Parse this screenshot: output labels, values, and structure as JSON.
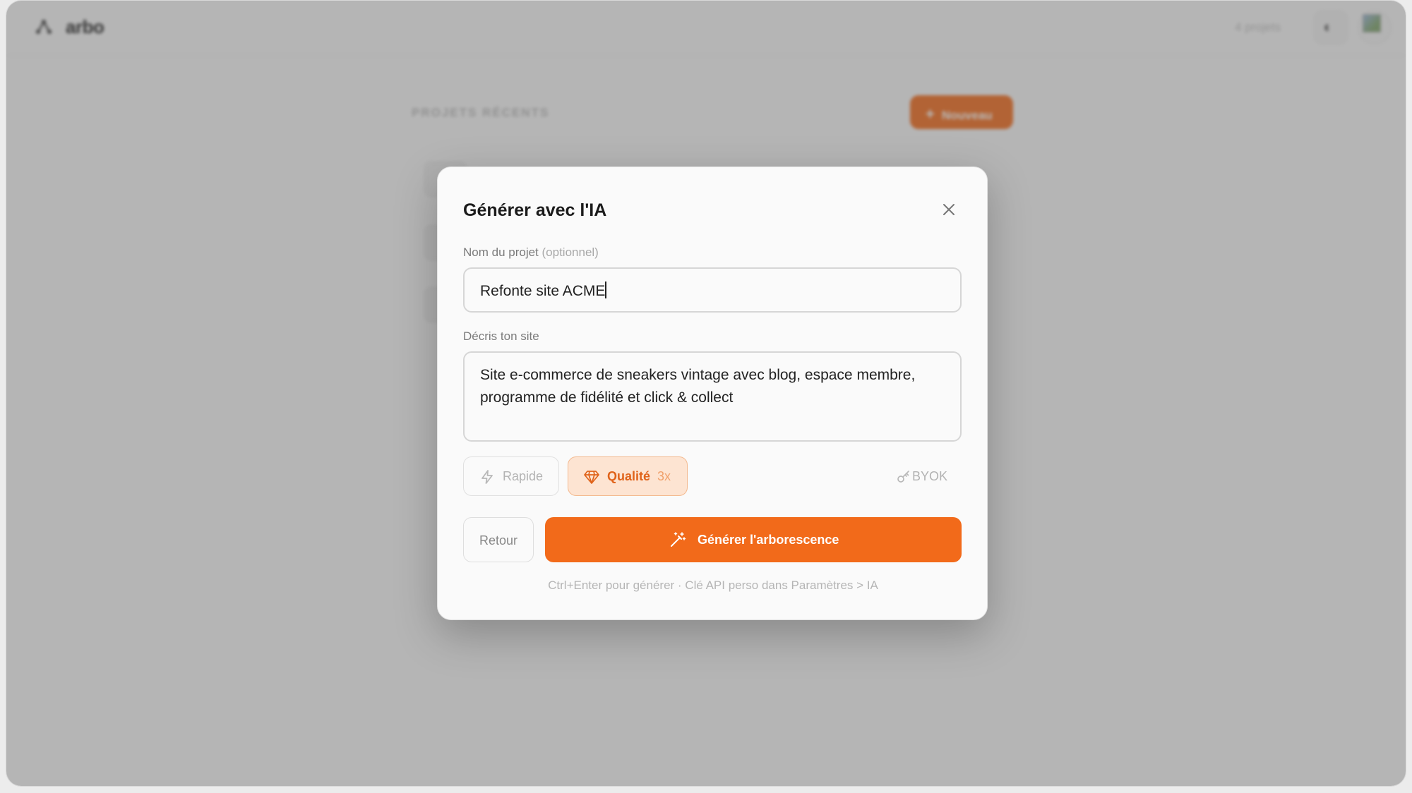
{
  "app": {
    "name": "arbo",
    "projects_count": "4 projets",
    "section_label": "PROJETS RÉCENTS",
    "new_button": "Nouveau"
  },
  "modal": {
    "title": "Générer avec l'IA",
    "name_label": "Nom du projet",
    "name_optional": "(optionnel)",
    "name_value": "Refonte site ACME",
    "description_label": "Décris ton site",
    "description_value": "Site e-commerce de sneakers vintage avec blog, espace membre, programme de fidélité et click & collect",
    "modes": {
      "fast_label": "Rapide",
      "quality_label": "Qualité",
      "quality_multiplier": "3x",
      "selected": "Qualité"
    },
    "byok_label": "BYOK",
    "back_button": "Retour",
    "generate_button": "Générer l'arborescence",
    "hint": "Ctrl+Enter pour générer · Clé API perso dans Paramètres > IA"
  },
  "colors": {
    "accent": "#f26a1a",
    "accent_soft": "#fde4d2",
    "overlay": "#8a8a8a"
  },
  "icons": {
    "logo": "tree-logo-icon",
    "theme": "moon-icon",
    "close": "close-icon",
    "fast": "lightning-icon",
    "quality": "diamond-icon",
    "byok": "key-icon",
    "generate": "magic-wand-icon"
  }
}
